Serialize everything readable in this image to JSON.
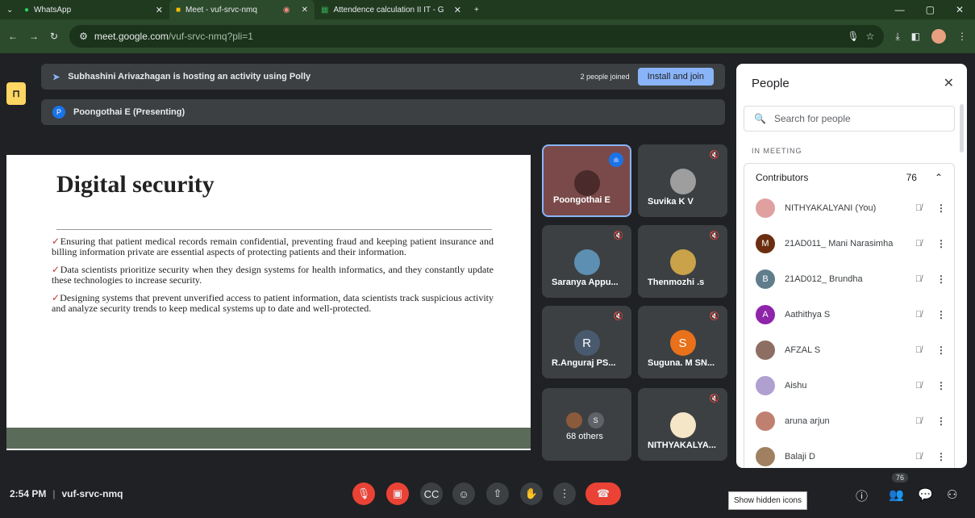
{
  "browser": {
    "tabs": [
      {
        "label": "WhatsApp",
        "icon": "whatsapp-icon"
      },
      {
        "label": "Meet - vuf-srvc-nmq",
        "icon": "meet-icon"
      },
      {
        "label": "Attendence calculation II IT - G",
        "icon": "sheets-icon"
      }
    ],
    "new_tab": "+",
    "url_host": "meet.google.com",
    "url_path": "/vuf-srvc-nmq?pli=1"
  },
  "banners": {
    "activity": "Subhashini Arivazhagan is hosting an activity using Polly",
    "joined": "2 people joined",
    "install_join": "Install and join",
    "presenting_initial": "P",
    "presenting": "Poongothai E (Presenting)"
  },
  "slide": {
    "title": "Digital security",
    "bullets": [
      "Ensuring that patient medical records remain confidential, preventing fraud and keeping patient insurance and billing information private are essential aspects of protecting patients and their information.",
      "Data scientists prioritize security when they design systems for health informatics, and they constantly update these technologies to increase security.",
      "Designing systems that prevent unverified access to patient information, data scientists track suspicious activity and analyze security trends to keep medical systems up to date and well-protected."
    ],
    "tick": "✓"
  },
  "tiles": [
    {
      "name": "Poongothai E",
      "initial": "",
      "color": "#7a4a4a"
    },
    {
      "name": "Suvika K V",
      "initial": "",
      "color": "#9e9e9e"
    },
    {
      "name": "Saranya Appu...",
      "initial": "",
      "color": "#5d8fb3"
    },
    {
      "name": "Thenmozhi .s",
      "initial": "",
      "color": "#c9a24a"
    },
    {
      "name": "R.Anguraj PS...",
      "initial": "R",
      "color": "#4a5a6e"
    },
    {
      "name": "Suguna. M SN...",
      "initial": "S",
      "color": "#e8711a"
    },
    {
      "name": "68 others",
      "initial": "S",
      "color": "#5f6368"
    },
    {
      "name": "NITHYAKALYA...",
      "initial": "",
      "color": "#f5e6c8"
    }
  ],
  "people": {
    "title": "People",
    "search_placeholder": "Search for people",
    "section": "IN MEETING",
    "group": "Contributors",
    "count": "76",
    "list": [
      {
        "name": "NITHYAKALYANI (You)",
        "initial": "",
        "color": "#e0a0a0"
      },
      {
        "name": "21AD011_ Mani Narasimha",
        "initial": "M",
        "color": "#6b2e10"
      },
      {
        "name": "21AD012_ Brundha",
        "initial": "B",
        "color": "#607d8b"
      },
      {
        "name": "Aathithya S",
        "initial": "A",
        "color": "#8e24aa"
      },
      {
        "name": "AFZAL S",
        "initial": "",
        "color": "#8d6e63"
      },
      {
        "name": "Aishu",
        "initial": "",
        "color": "#b0a0d0"
      },
      {
        "name": "aruna arjun",
        "initial": "",
        "color": "#c08070"
      },
      {
        "name": "Balaji D",
        "initial": "",
        "color": "#a08060"
      }
    ]
  },
  "bottom": {
    "time": "2:54 PM",
    "sep": "|",
    "code": "vuf-srvc-nmq",
    "participant_badge": "76",
    "tooltip": "Show hidden icons"
  }
}
